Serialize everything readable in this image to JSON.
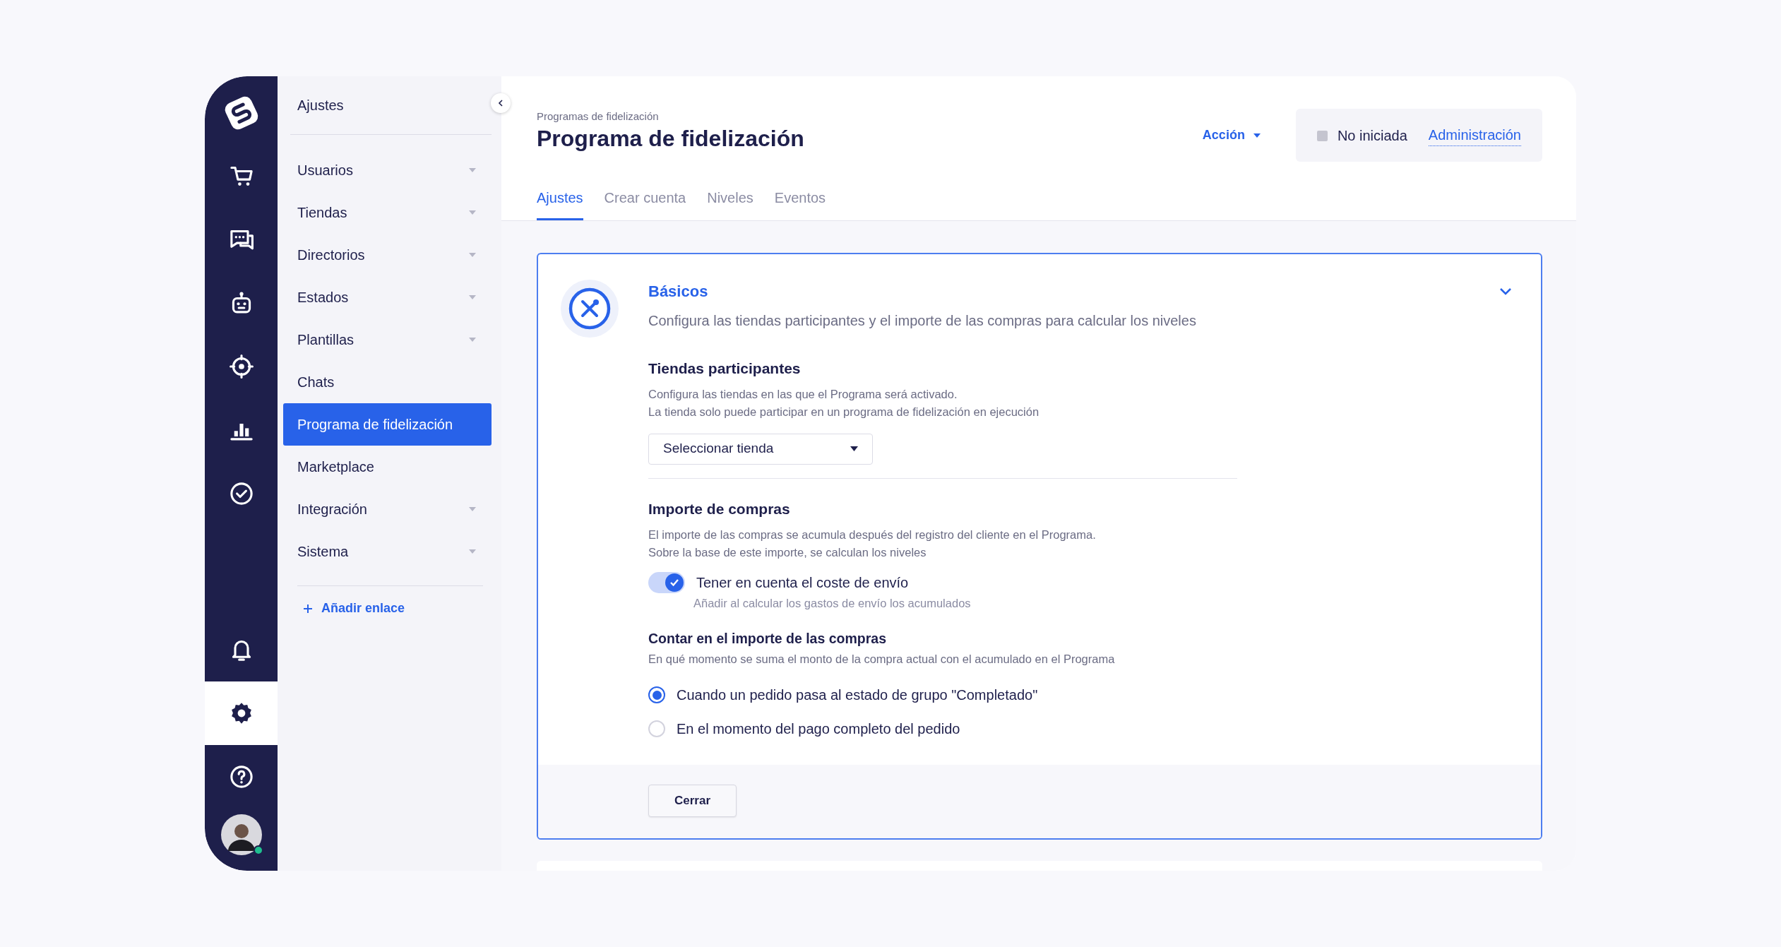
{
  "rail": {
    "items": [
      {
        "kind": "cart",
        "selected": false
      },
      {
        "kind": "chat",
        "selected": false
      },
      {
        "kind": "robot",
        "selected": false
      },
      {
        "kind": "target",
        "selected": false
      },
      {
        "kind": "chart",
        "selected": false
      },
      {
        "kind": "check",
        "selected": false
      },
      {
        "kind": "bell",
        "selected": false
      },
      {
        "kind": "gear",
        "selected": true
      },
      {
        "kind": "help",
        "selected": false
      }
    ],
    "user": {
      "online": true
    }
  },
  "sidebar": {
    "title": "Ajustes",
    "items": [
      {
        "label": "Usuarios",
        "expandable": true,
        "selected": false
      },
      {
        "label": "Tiendas",
        "expandable": true,
        "selected": false
      },
      {
        "label": "Directorios",
        "expandable": true,
        "selected": false
      },
      {
        "label": "Estados",
        "expandable": true,
        "selected": false
      },
      {
        "label": "Plantillas",
        "expandable": true,
        "selected": false
      },
      {
        "label": "Chats",
        "expandable": false,
        "selected": false
      },
      {
        "label": "Programa de fidelización",
        "expandable": false,
        "selected": true
      },
      {
        "label": "Marketplace",
        "expandable": false,
        "selected": false
      },
      {
        "label": "Integración",
        "expandable": true,
        "selected": false
      },
      {
        "label": "Sistema",
        "expandable": true,
        "selected": false
      }
    ],
    "add_link": "Añadir enlace"
  },
  "header": {
    "breadcrumb": "Programas de fidelización",
    "title": "Programa de fidelización",
    "action": "Acción",
    "status": "No iniciada",
    "admin_link": "Administración"
  },
  "tabs": [
    {
      "label": "Ajustes",
      "selected": true
    },
    {
      "label": "Crear cuenta",
      "selected": false
    },
    {
      "label": "Niveles",
      "selected": false
    },
    {
      "label": "Eventos",
      "selected": false
    }
  ],
  "section": {
    "title": "Básicos",
    "description": "Configura las tiendas participantes y el importe de las compras para calcular los niveles",
    "stores": {
      "heading": "Tiendas participantes",
      "lines": [
        "Configura las tiendas en las que el Programa será activado.",
        "La tienda solo puede participar en un programa de fidelización en ejecución"
      ],
      "select": "Seleccionar tienda"
    },
    "amount": {
      "heading": "Importe de compras",
      "lines": [
        "El importe de las compras se acumula después del registro del cliente en el Programa.",
        "Sobre la base de este importe, se calculan los niveles"
      ],
      "toggle": {
        "label": "Tener en cuenta el coste de envío",
        "hint": "Añadir al calcular los gastos de envío los acumulados",
        "on": true
      }
    },
    "count": {
      "heading": "Contar en el importe de las compras",
      "description": "En qué momento se suma el monto de la compra actual con el acumulado en el Programa",
      "options": [
        {
          "label": "Cuando un pedido pasa al estado de grupo \"Completado\"",
          "selected": true
        },
        {
          "label": "En el momento del pago completo del pedido",
          "selected": false
        }
      ]
    },
    "close_button": "Cerrar"
  }
}
